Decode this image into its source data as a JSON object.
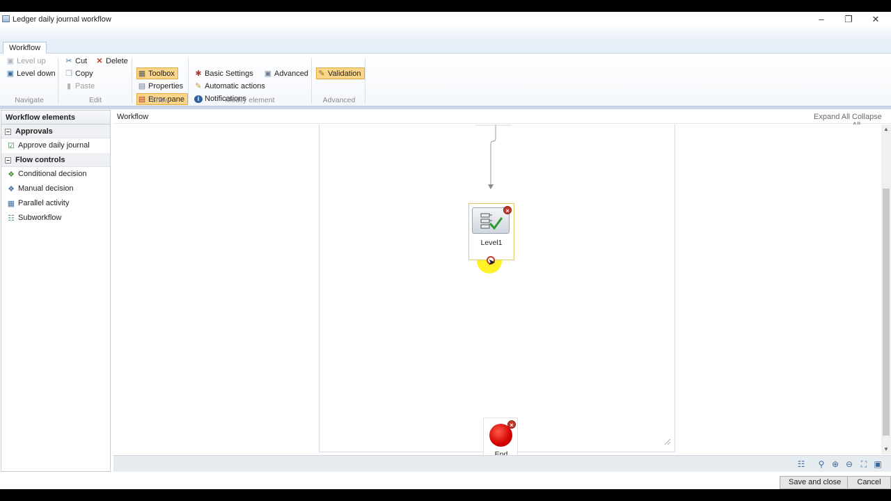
{
  "window": {
    "title": "Ledger daily journal workflow"
  },
  "ribbon": {
    "tab": "Workflow",
    "navigate": {
      "level_up": "Level up",
      "level_down": "Level down",
      "label": "Navigate"
    },
    "edit": {
      "cut": "Cut",
      "delete": "Delete",
      "copy": "Copy",
      "paste": "Paste",
      "label": "Edit"
    },
    "show": {
      "toolbox": "Toolbox",
      "properties": "Properties",
      "error_pane": "Error pane",
      "label": "Show"
    },
    "modify": {
      "basic_settings": "Basic Settings",
      "advanced": "Advanced",
      "automatic_actions": "Automatic actions",
      "notifications": "Notifications",
      "label": "Modify element"
    },
    "advanced": {
      "validation": "Validation",
      "label": "Advanced"
    }
  },
  "left_panel": {
    "title": "Workflow elements",
    "sections": [
      {
        "label": "Approvals",
        "items": [
          "Approve daily journal"
        ]
      },
      {
        "label": "Flow controls",
        "items": [
          "Conditional decision",
          "Manual decision",
          "Parallel activity",
          "Subworkflow"
        ]
      }
    ]
  },
  "workflow_header": {
    "title": "Workflow",
    "expand_all": "Expand All",
    "collapse_all": "Collapse All"
  },
  "nodes": {
    "level": "Level1",
    "end": "End"
  },
  "footer": {
    "save_close": "Save and close",
    "cancel": "Cancel"
  },
  "colors": {
    "active_button": "#fbd68a",
    "end_node": "#d40000",
    "highlight": "#fff000"
  }
}
